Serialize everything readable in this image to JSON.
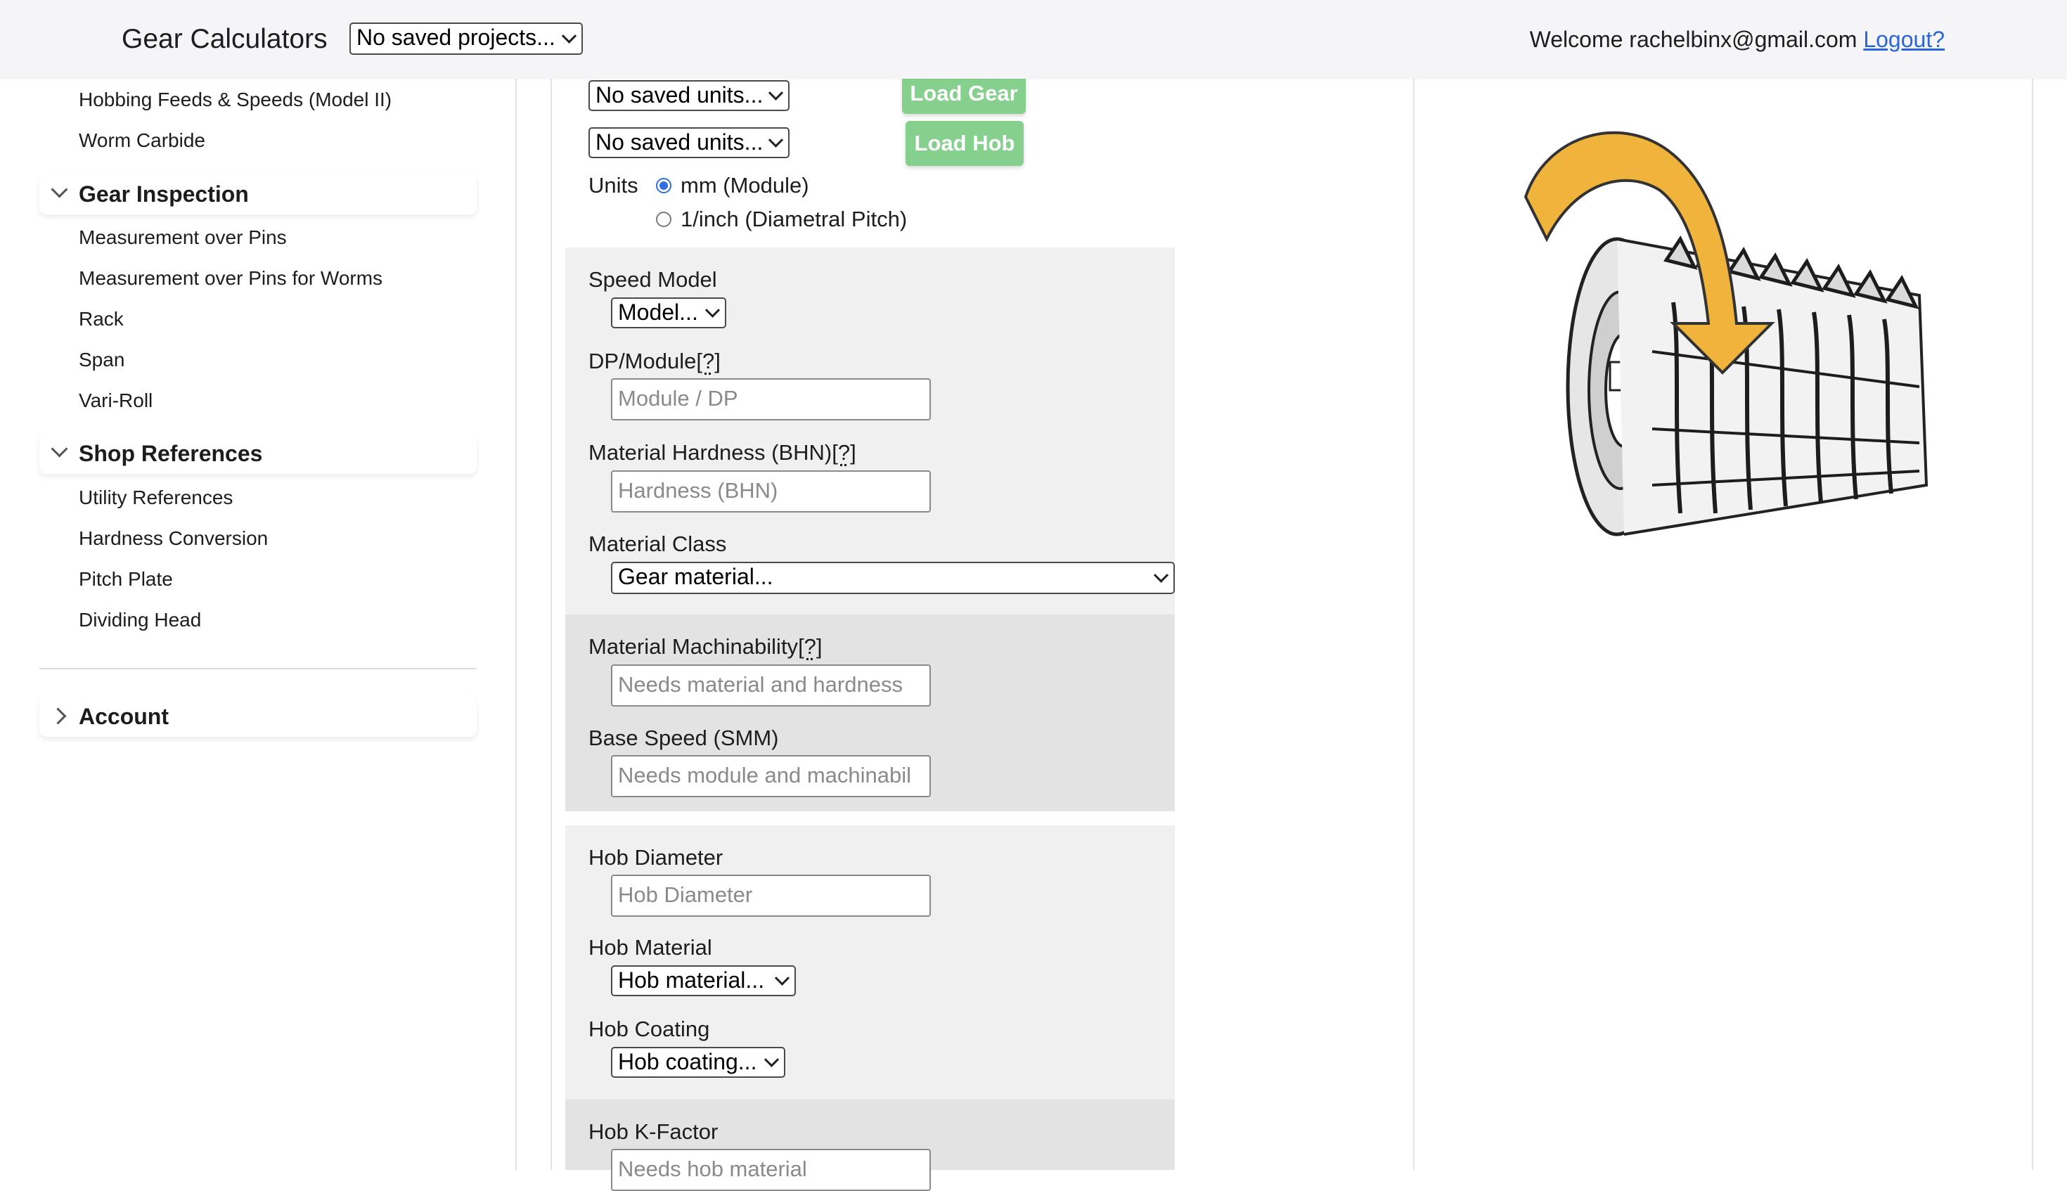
{
  "header": {
    "app_title": "Gear Calculators",
    "project_select": "No saved projects...",
    "welcome_text": "Welcome rachelbinx@gmail.com",
    "logout_label": "Logout?"
  },
  "sidebar": {
    "top_links": [
      "Hobbing Feeds & Speeds (Model II)",
      "Worm Carbide"
    ],
    "gear_inspection": {
      "label": "Gear Inspection",
      "items": [
        "Measurement over Pins",
        "Measurement over Pins for Worms",
        "Rack",
        "Span",
        "Vari-Roll"
      ]
    },
    "shop_references": {
      "label": "Shop References",
      "items": [
        "Utility References",
        "Hardness Conversion",
        "Pitch Plate",
        "Dividing Head"
      ]
    },
    "account": {
      "label": "Account"
    }
  },
  "form": {
    "gear_units_select": "No saved units...",
    "hob_units_select": "No saved units...",
    "load_gear_label": "Load Gear",
    "load_hob_label": "Load Hob",
    "units_label": "Units",
    "units_options": [
      "mm (Module)",
      "1/inch (Diametral Pitch)"
    ],
    "units_selected": "mm (Module)",
    "speed_model_label": "Speed Model",
    "speed_model_select": "Model...",
    "dp_module_label": "DP/Module",
    "help_marker": "[?]",
    "dp_module_placeholder": "Module / DP",
    "hardness_label": "Material Hardness (BHN)",
    "hardness_placeholder": "Hardness (BHN)",
    "material_class_label": "Material Class",
    "material_class_select": "Gear material...",
    "machinability_label": "Material Machinability",
    "machinability_placeholder": "Needs material and hardness",
    "base_speed_label": "Base Speed (SMM)",
    "base_speed_placeholder": "Needs module and machinabil",
    "hob_diameter_label": "Hob Diameter",
    "hob_diameter_placeholder": "Hob Diameter",
    "hob_material_label": "Hob Material",
    "hob_material_select": "Hob material...",
    "hob_coating_label": "Hob Coating",
    "hob_coating_select": "Hob coating...",
    "hob_kfactor_label": "Hob K-Factor",
    "hob_kfactor_placeholder": "Needs hob material"
  },
  "illustration": {
    "name": "hob-rotation-illustration",
    "arrow_color": "#f0b43c"
  }
}
